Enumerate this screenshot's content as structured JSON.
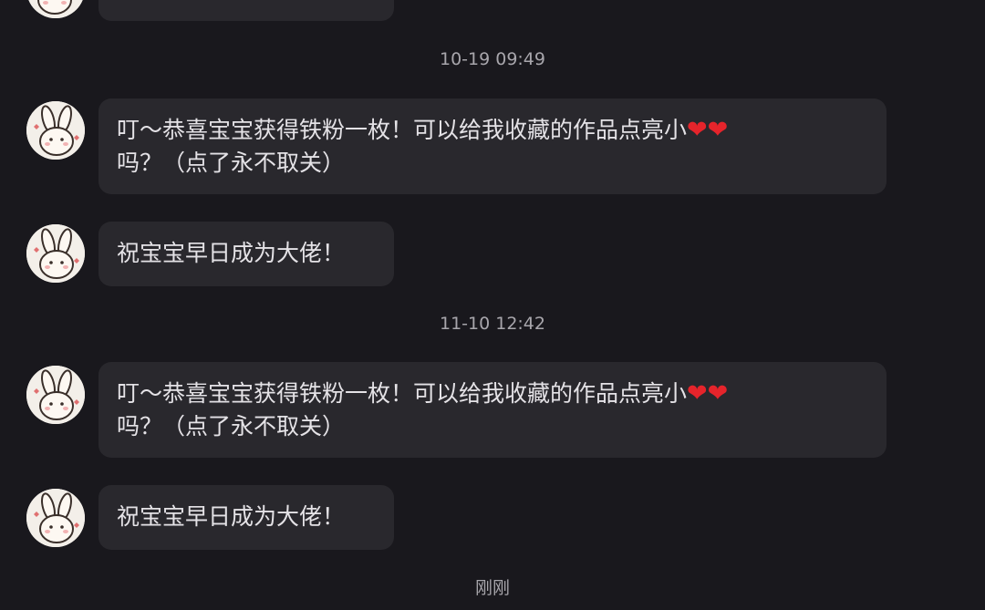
{
  "timestamps": [
    "10-19 09:49",
    "11-10 12:42",
    "刚刚"
  ],
  "messages": [
    {
      "line1": "叮～恭喜宝宝获得铁粉一枚！可以给我收藏的作品点亮小",
      "hearts": "❤❤",
      "line2": "吗？（点了永不取关）"
    },
    {
      "text": "祝宝宝早日成为大佬！"
    },
    {
      "line1": "叮～恭喜宝宝获得铁粉一枚！可以给我收藏的作品点亮小",
      "hearts": "❤❤",
      "line2": "吗？（点了永不取关）"
    },
    {
      "text": "祝宝宝早日成为大佬！"
    }
  ],
  "colors": {
    "background": "#19181d",
    "bubble": "#29282d",
    "heart": "#e5242b"
  },
  "icons": {
    "avatar": "bunny-avatar-icon"
  }
}
